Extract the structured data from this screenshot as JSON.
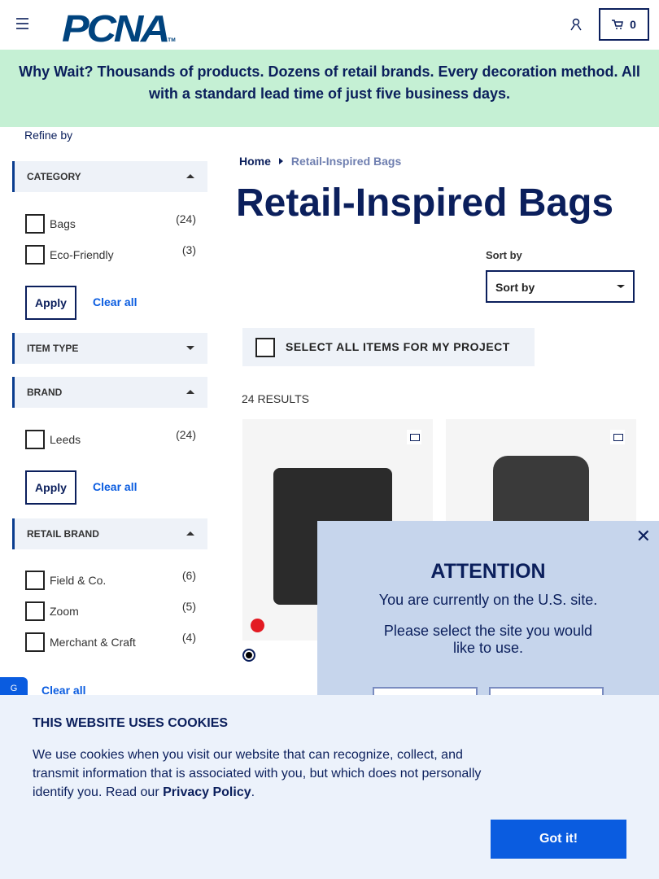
{
  "header": {
    "logo": "PCNA",
    "tm": "TM",
    "cart_count": "0"
  },
  "banner": "Why Wait? Thousands of products. Dozens of retail brands. Every decoration method. All with a standard lead time of just five business days.",
  "sidebar": {
    "refine_label": "Refine by",
    "apply": "Apply",
    "clear_all": "Clear all",
    "facets": [
      {
        "title": "CATEGORY",
        "expanded": true,
        "options": [
          {
            "label": "Bags",
            "count": "(24)"
          },
          {
            "label": "Eco-Friendly",
            "count": "(3)"
          }
        ]
      },
      {
        "title": "ITEM TYPE",
        "expanded": false
      },
      {
        "title": "BRAND",
        "expanded": true,
        "options": [
          {
            "label": "Leeds",
            "count": "(24)"
          }
        ]
      },
      {
        "title": "RETAIL BRAND",
        "expanded": true,
        "options": [
          {
            "label": "Field & Co.",
            "count": "(6)"
          },
          {
            "label": "Zoom",
            "count": "(5)"
          },
          {
            "label": "Merchant & Craft",
            "count": "(4)"
          }
        ]
      }
    ]
  },
  "breadcrumb": {
    "home": "Home",
    "current": "Retail-Inspired Bags"
  },
  "page_title": "Retail-Inspired Bags",
  "sort": {
    "label": "Sort by",
    "value": "Sort by"
  },
  "select_all": "SELECT ALL ITEMS FOR MY PROJECT",
  "results": "24 RESULTS",
  "modal": {
    "title": "ATTENTION",
    "line1": "You are currently on the U.S. site.",
    "line2": "Please select the site you would like to use."
  },
  "feedback": "G",
  "cookie": {
    "title": "THIS WEBSITE USES COOKIES",
    "text": "We use cookies when you visit our website that can recognize, collect, and transmit information that is associated with you, but which does not personally identify you. Read our ",
    "link": "Privacy Policy",
    "end": ".",
    "button": "Got it!"
  },
  "colors": {
    "navy": "#0b1f5c",
    "banner": "#c5f0d4",
    "accent": "#0a5ce0",
    "modal": "#c6d5ec"
  }
}
